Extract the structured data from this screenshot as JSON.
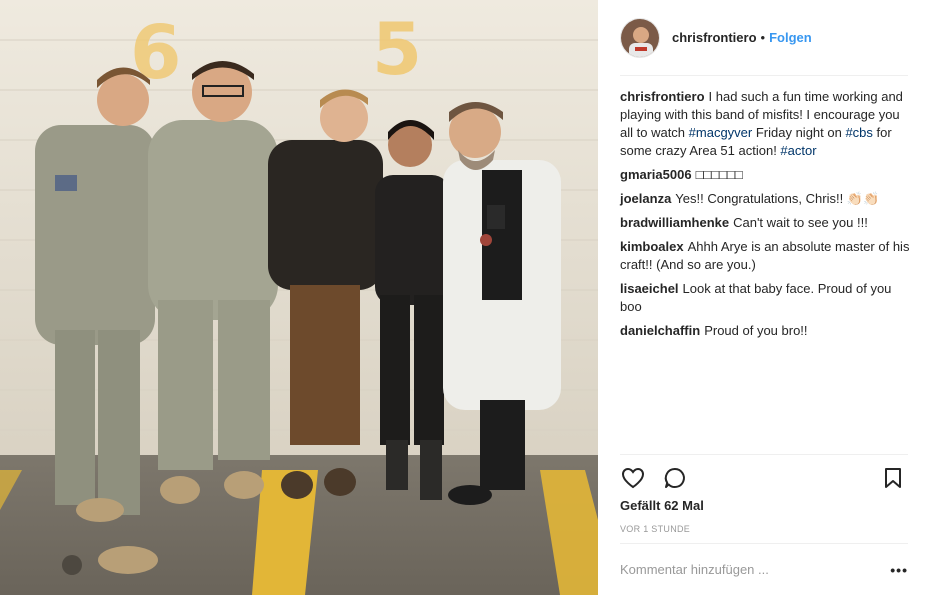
{
  "post": {
    "author": {
      "username": "chrisfrontiero",
      "separator": "•",
      "follow_label": "Folgen"
    },
    "caption": {
      "username": "chrisfrontiero",
      "text_1": "I had such a fun time working and playing with this band of misfits! I encourage you all to watch ",
      "tag_1": "#macgyver",
      "text_2": " Friday night on ",
      "tag_2": "#cbs",
      "text_3": " for some crazy Area 51 action! ",
      "tag_3": "#actor"
    },
    "comments": [
      {
        "username": "gmaria5006",
        "text": "□□□□□□"
      },
      {
        "username": "joelanza",
        "text": "Yes!! Congratulations, Chris!! 👏🏻👏🏻"
      },
      {
        "username": "bradwilliamhenke",
        "text": "Can't wait to see you !!!"
      },
      {
        "username": "kimboalex",
        "text": "Ahhh Arye is an absolute master of his craft!! (And so are you.)"
      },
      {
        "username": "lisaeichel",
        "text": "Look at that baby face. Proud of you boo"
      },
      {
        "username": "danielchaffin",
        "text": "Proud of you bro!!"
      }
    ],
    "likes": "Gefällt 62 Mal",
    "timestamp": "VOR 1 STUNDE",
    "comment_placeholder": "Kommentar hinzufügen ...",
    "more_label": "•••",
    "photo": {
      "wall_numbers": [
        "6",
        "5"
      ],
      "colors": {
        "wall": "#e9e3d6",
        "floor": "#8a8478",
        "stripe": "#e2b637",
        "stencil": "#f0c870"
      }
    },
    "icons": [
      "heart-icon",
      "comment-icon",
      "bookmark-icon",
      "more-options-icon"
    ],
    "accent_color": "#3897f0",
    "hashtag_color": "#003569"
  }
}
